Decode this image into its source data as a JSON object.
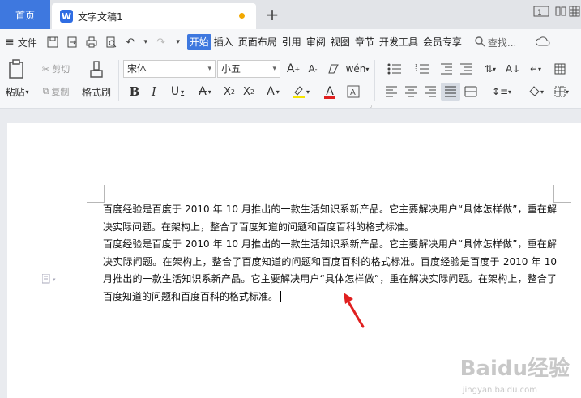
{
  "tabs": {
    "home_label": "首页",
    "doc_label": "文字文稿1",
    "app_logo": "W",
    "add_icon": "+"
  },
  "menubar": {
    "file_label": "文件",
    "items": [
      "开始",
      "插入",
      "页面布局",
      "引用",
      "审阅",
      "视图",
      "章节",
      "开发工具",
      "会员专享"
    ],
    "active_item": "开始",
    "search_label": "查找..."
  },
  "ribbon": {
    "paste_label": "粘贴",
    "cut_label": "剪切",
    "copy_label": "复制",
    "format_painter_label": "格式刷",
    "font_name": "宋体",
    "font_size": "小五"
  },
  "document": {
    "paragraphs": [
      "百度经验是百度于 2010 年 10 月推出的一款生活知识系新产品。它主要解决用户“具体怎样做”，重在解决实际问题。在架构上，整合了百度知道的问题和百度百科的格式标准。",
      "百度经验是百度于 2010 年 10 月推出的一款生活知识系新产品。它主要解决用户“具体怎样做”，重在解决实际问题。在架构上，整合了百度知道的问题和百度百科的格式标准。百度经验是百度于 2010 年 10 月推出的一款生活知识系新产品。它主要解决用户“具体怎样做”，重在解决实际问题。在架构上，整合了百度知道的问题和百度百科的格式标准。"
    ]
  },
  "watermark": {
    "text": "Baidu经验",
    "url": "jingyan.baidu.com"
  },
  "colors": {
    "accent": "#3e78df",
    "arrow": "#e02020",
    "unsaved_dot": "#f2a800"
  }
}
